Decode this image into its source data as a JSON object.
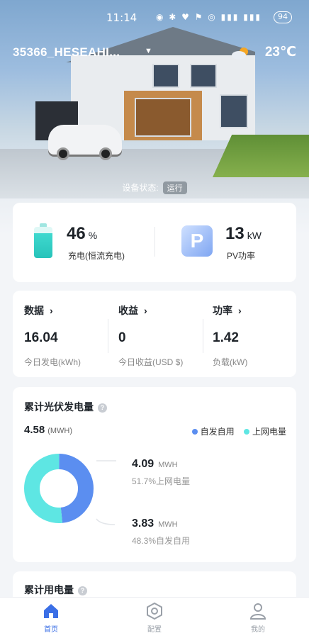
{
  "status_bar": {
    "time": "11:14",
    "icons": "◉ ✱ ♥ ⚑ ◎ ▮▮▮ ▮▮▮",
    "battery": "94"
  },
  "header": {
    "plant_name": "35366_HESEAHI...",
    "temperature": "23℃"
  },
  "device_status": {
    "label": "设备状态:",
    "value": "运行"
  },
  "summary": {
    "battery_percent": "46",
    "battery_unit": "%",
    "battery_caption": "充电(恒流充电)",
    "pv_power": "13",
    "pv_unit": "kW",
    "pv_caption": "PV功率"
  },
  "stats": [
    {
      "title": "数据",
      "value": "16.04",
      "caption": "今日发电(kWh)"
    },
    {
      "title": "收益",
      "value": "0",
      "caption": "今日收益(USD $)"
    },
    {
      "title": "功率",
      "value": "1.42",
      "caption": "负载(kW)"
    }
  ],
  "pv_generation": {
    "title": "累计光伏发电量",
    "total_value": "4.58",
    "total_unit": "(MWH)",
    "legend": [
      {
        "label": "自发自用",
        "color": "#5b8ef0"
      },
      {
        "label": "上网电量",
        "color": "#5ee6e3"
      }
    ],
    "grid": {
      "value": "4.09",
      "unit": "MWH",
      "desc": "51.7%上网电量",
      "percent": 51.7
    },
    "self": {
      "value": "3.83",
      "unit": "MWH",
      "desc": "48.3%自发自用",
      "percent": 48.3
    }
  },
  "consumption": {
    "title": "累计用电量"
  },
  "tabs": [
    {
      "label": "首页",
      "active": true
    },
    {
      "label": "配置",
      "active": false
    },
    {
      "label": "我的",
      "active": false
    }
  ]
}
